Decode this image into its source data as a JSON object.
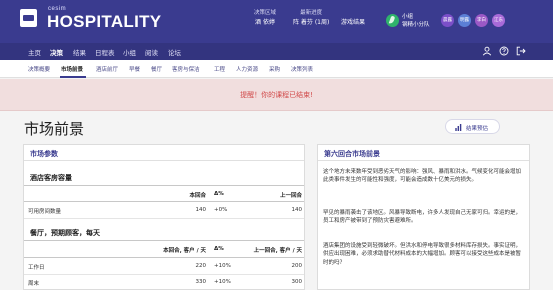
{
  "header": {
    "brand_small": "cesim",
    "brand_big": "HOSPITALITY",
    "market_label": "决策区域",
    "market_value": "酒 依婷",
    "round_label": "最新进度",
    "round_value": "阵 着芬 (1周)",
    "game_label": "游戏结果",
    "team_name": "小组",
    "team_member": "钢精小分队",
    "avatars": [
      {
        "label": "晨露",
        "color": "#7b4fc8"
      },
      {
        "label": "明露",
        "color": "#5b7fd6"
      },
      {
        "label": "李白",
        "color": "#9b59c6"
      },
      {
        "label": "江东",
        "color": "#a86ad8"
      }
    ]
  },
  "mainnav": {
    "items": [
      "主页",
      "决策",
      "结果",
      "日程表",
      "小组",
      "阅读",
      "论坛"
    ],
    "active": "决策"
  },
  "subnav": {
    "items": [
      "决策概要",
      "市场前景",
      "酒店前厅",
      "早餐",
      "餐厅",
      "客房与保洁",
      "工程",
      "人力资源",
      "采购",
      "决策列表"
    ],
    "active": "市场前景"
  },
  "alert": {
    "text": "提醒！你的课程已结束!"
  },
  "page": {
    "title": "市场前景",
    "results_button": "结果预估"
  },
  "market_params": {
    "panel_title": "市场参数",
    "capacity": {
      "section_title": "酒店客房容量",
      "headers": [
        "本回合",
        "Δ%",
        "上一回合"
      ],
      "rows": [
        {
          "label": "可用房间数量",
          "current": "140",
          "delta": "+0%",
          "previous": "140"
        }
      ]
    },
    "restaurant": {
      "section_title": "餐厅，预期顾客，每天",
      "headers": [
        "本回合, 客户 / 天",
        "Δ%",
        "上一回合, 客户 / 天"
      ],
      "rows": [
        {
          "label": "工作日",
          "current": "220",
          "delta": "+10%",
          "previous": "200"
        },
        {
          "label": "周末",
          "current": "330",
          "delta": "+10%",
          "previous": "300"
        }
      ]
    }
  },
  "news": {
    "panel_title": "第六回合市场前景",
    "paragraphs": [
      "这个地方未来数年受到恶劣天气的影响：强风、暴雨和洪水。气候变化可能会增加此类事件发生的可能性和强度，可能会造成数十亿美元的损失。",
      "罕见的暴雨袭击了该地区。风暴导致断电，许多人发现自己无家可归。幸运的是，员工和房产被带到了预防灾害避难所。",
      "酒店集团的设施受到轻微破坏。但洪水和停电导致很多材料库存损失。事实证明，供应出现困难，必须求助替代材料成本的大幅增加。顾客可以接受这些成本是被暂时的吗？"
    ]
  },
  "colors": {
    "primary": "#3a3b8f",
    "alert_bg": "#f1dede",
    "alert_text": "#d14a4a"
  }
}
